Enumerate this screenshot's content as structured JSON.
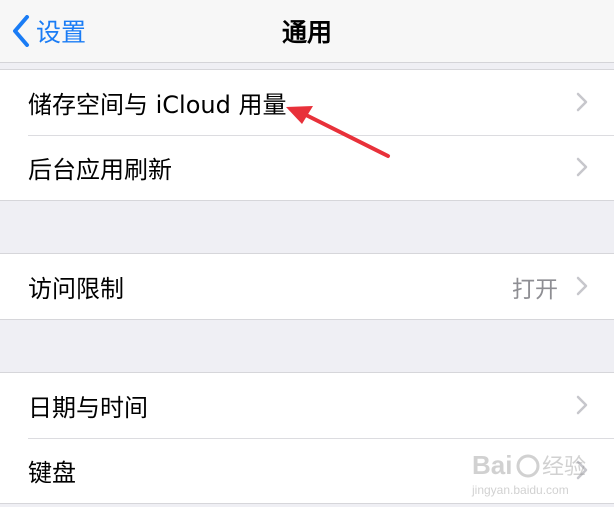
{
  "nav": {
    "back_label": "设置",
    "title": "通用"
  },
  "groups": [
    {
      "rows": [
        {
          "label": "储存空间与 iCloud 用量"
        },
        {
          "label": "后台应用刷新"
        }
      ]
    },
    {
      "rows": [
        {
          "label": "访问限制",
          "value": "打开"
        }
      ]
    },
    {
      "rows": [
        {
          "label": "日期与时间"
        },
        {
          "label": "键盘"
        }
      ]
    }
  ],
  "watermark": {
    "brand": "Baidu 经验",
    "url": "jingyan.baidu.com"
  },
  "colors": {
    "accent": "#1a7cf5",
    "annotation": "#e8313a",
    "background": "#efeff4"
  }
}
